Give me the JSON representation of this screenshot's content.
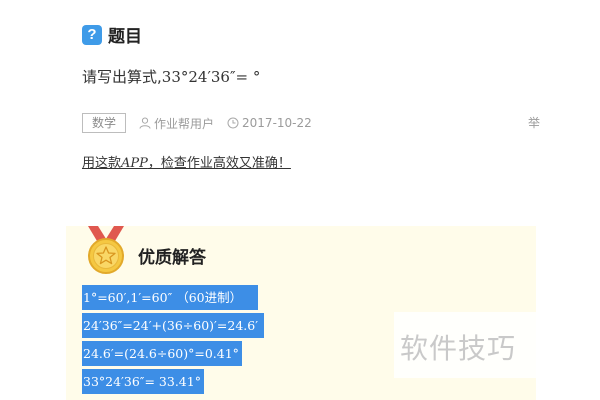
{
  "question": {
    "badge_glyph": "?",
    "title": "题目",
    "prefix": "请写出算式,",
    "formula": "33°24′36″= °",
    "tag": "数学",
    "user": "作业帮用户",
    "date": "2017-10-22",
    "edge_char": "举"
  },
  "promo": {
    "before": "用这款",
    "app": "APP",
    "after": "，检查作业高效又准确！"
  },
  "answer": {
    "title": "优质解答",
    "lines": [
      "1°=60′,1′=60″ （60进制）",
      "24′36″=24′+(36÷60)′=24.6′",
      "24.6′=(24.6÷60)°=0.41°",
      "33°24′36″= 33.41°"
    ]
  },
  "watermark": "软件技巧",
  "colors": {
    "badge_blue": "#3f9be8",
    "selection_blue": "#3d8ee6",
    "panel_bg": "#fffcea",
    "medal_gold": "#f5c842",
    "ribbon_red": "#e0584f"
  }
}
